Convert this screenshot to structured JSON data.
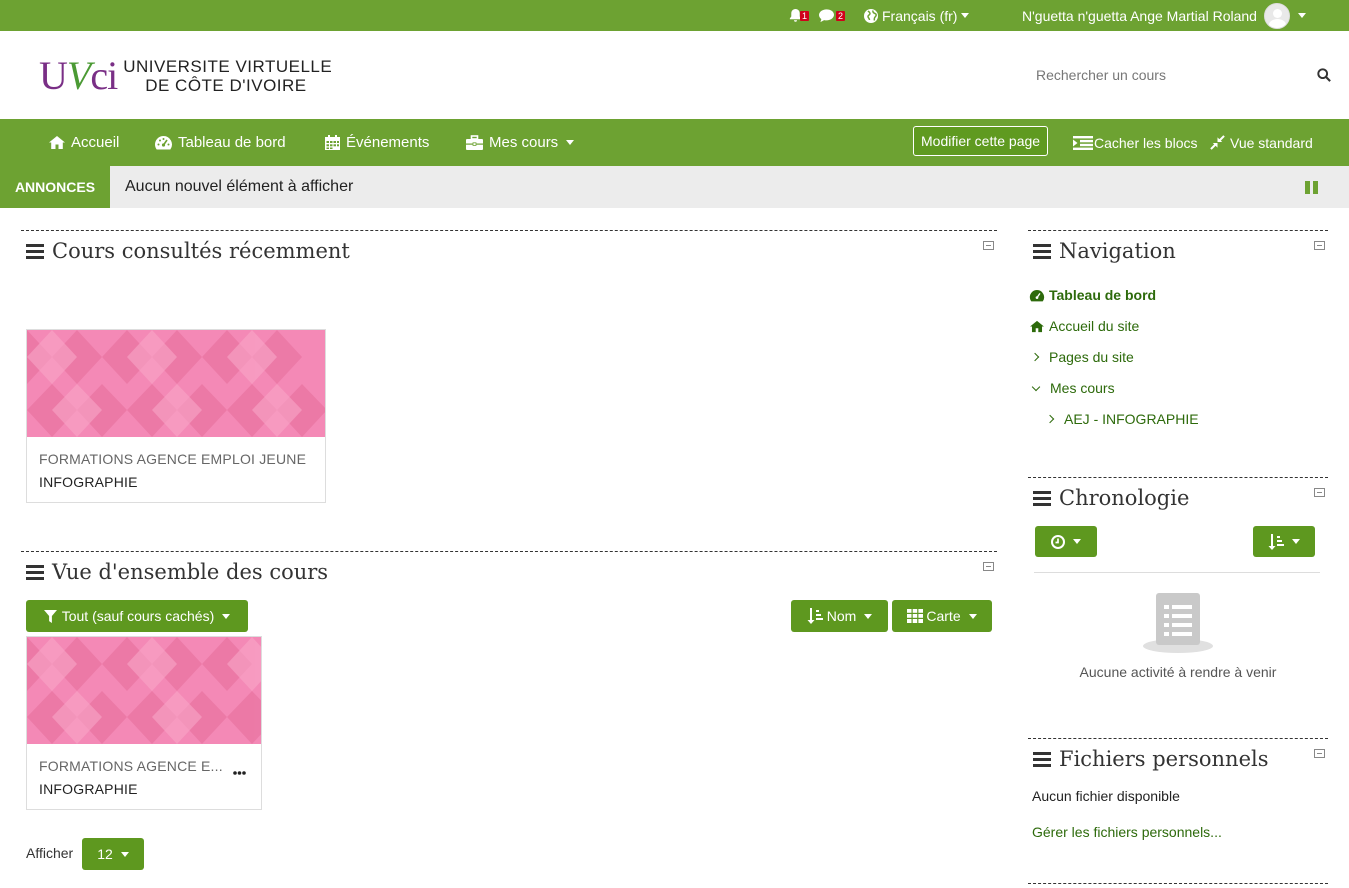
{
  "colors": {
    "brand_green": "#6da232",
    "button_green": "#5e981f",
    "link_green": "#2d6a0b",
    "badge_red": "#d0021b",
    "course_pink": "#f489b6"
  },
  "topbar": {
    "notifications_count": "1",
    "messages_count": "2",
    "language_label": "Français (fr)",
    "user_name": "N'guetta n'guetta Ange Martial Roland"
  },
  "header": {
    "logo": {
      "line1": "UNIVERSITE VIRTUELLE",
      "line2": "DE CÔTE D'IVOIRE"
    },
    "search_placeholder": "Rechercher un cours"
  },
  "navbar": {
    "items": [
      {
        "label": "Accueil",
        "icon": "home-icon"
      },
      {
        "label": "Tableau de bord",
        "icon": "dashboard-icon"
      },
      {
        "label": "Événements",
        "icon": "calendar-icon"
      },
      {
        "label": "Mes cours",
        "icon": "briefcase-icon"
      }
    ],
    "edit_button": "Modifier cette page",
    "hide_blocks": "Cacher les blocs",
    "standard_view": "Vue standard"
  },
  "announcements": {
    "label": "ANNONCES",
    "text": "Aucun nouvel élément à afficher"
  },
  "recent_courses": {
    "title": "Cours consultés récemment",
    "course": {
      "category": "FORMATIONS AGENCE EMPLOI JEUNE",
      "name": "INFOGRAPHIE"
    }
  },
  "overview": {
    "title": "Vue d'ensemble des cours",
    "filter_label": "Tout (sauf cours cachés)",
    "sort_label": "Nom",
    "view_label": "Carte",
    "course": {
      "category": "FORMATIONS AGENCE E...",
      "name": "INFOGRAPHIE"
    },
    "show_label": "Afficher",
    "per_page": "12"
  },
  "navigation": {
    "title": "Navigation",
    "dashboard": "Tableau de bord",
    "site_home": "Accueil du site",
    "site_pages": "Pages du site",
    "my_courses": "Mes cours",
    "course": "AEJ - INFOGRAPHIE"
  },
  "timeline": {
    "title": "Chronologie",
    "empty": "Aucune activité à rendre à venir"
  },
  "private_files": {
    "title": "Fichiers personnels",
    "empty": "Aucun fichier disponible",
    "manage": "Gérer les fichiers personnels..."
  }
}
